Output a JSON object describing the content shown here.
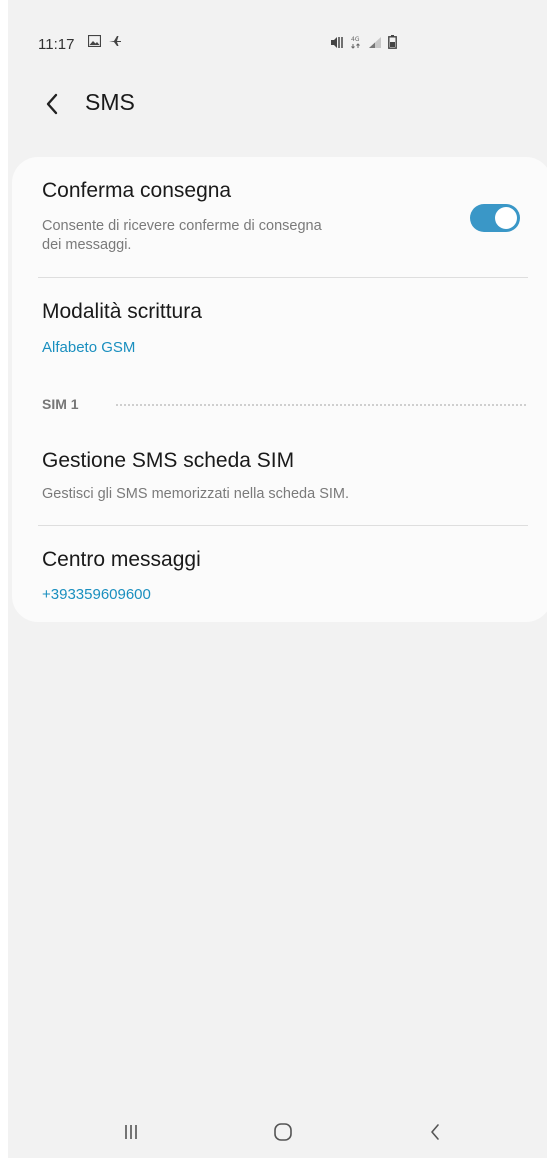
{
  "status_bar": {
    "time": "11:17",
    "icons_left": [
      "gallery-icon",
      "airplane-icon"
    ],
    "icons_right": [
      "mute-icon",
      "4g-icon",
      "signal-icon",
      "battery-icon"
    ]
  },
  "app_bar": {
    "back_icon": "chevron-left-icon",
    "title": "SMS"
  },
  "settings": {
    "delivery_report": {
      "title": "Conferma consegna",
      "description_line1": "Consente di ricevere conferme di consegna",
      "description_line2": "dei messaggi.",
      "toggle_on": true
    },
    "input_mode": {
      "title": "Modalità scrittura",
      "value": "Alfabeto GSM"
    },
    "sim_section": {
      "label": "SIM 1"
    },
    "sim_messages": {
      "title": "Gestione SMS scheda SIM",
      "description": "Gestisci gli SMS memorizzati nella scheda SIM."
    },
    "message_center": {
      "title": "Centro messaggi",
      "value": "+393359609600"
    }
  },
  "nav_bar": {
    "buttons": [
      "recents-icon",
      "home-icon",
      "back-icon"
    ]
  },
  "colors": {
    "accent": "#1a8fbf",
    "toggle": "#3a97c7",
    "background": "#f2f2f2",
    "card": "#fbfbfb"
  }
}
